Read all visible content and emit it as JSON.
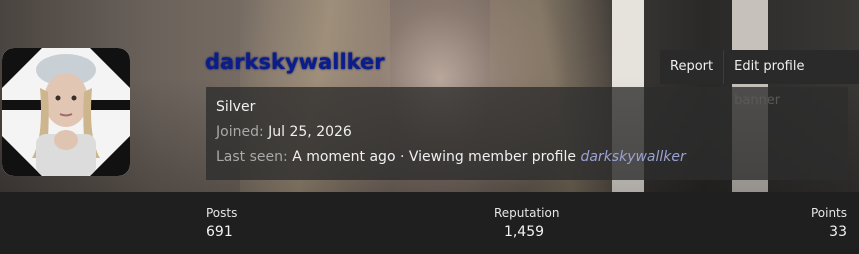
{
  "user": {
    "username": "darkskywallker",
    "rank": "Silver",
    "joined_label": "Joined:",
    "joined_value": "Jul 25, 2026",
    "last_seen_label": "Last seen:",
    "last_seen_value": "A moment ago · Viewing member profile",
    "last_seen_link": "darkskywallker"
  },
  "actions": {
    "report_label": "Report",
    "edit_banner_label": "Edit profile banner"
  },
  "stats": {
    "posts_label": "Posts",
    "posts_value": "691",
    "reputation_label": "Reputation",
    "reputation_value": "1,459",
    "points_label": "Points",
    "points_value": "33"
  },
  "colors": {
    "username": "#0a1d8c",
    "stats_bg": "#1f1f1f",
    "info_panel": "#2d2d2d"
  },
  "icons": {
    "avatar": "user-photo"
  }
}
